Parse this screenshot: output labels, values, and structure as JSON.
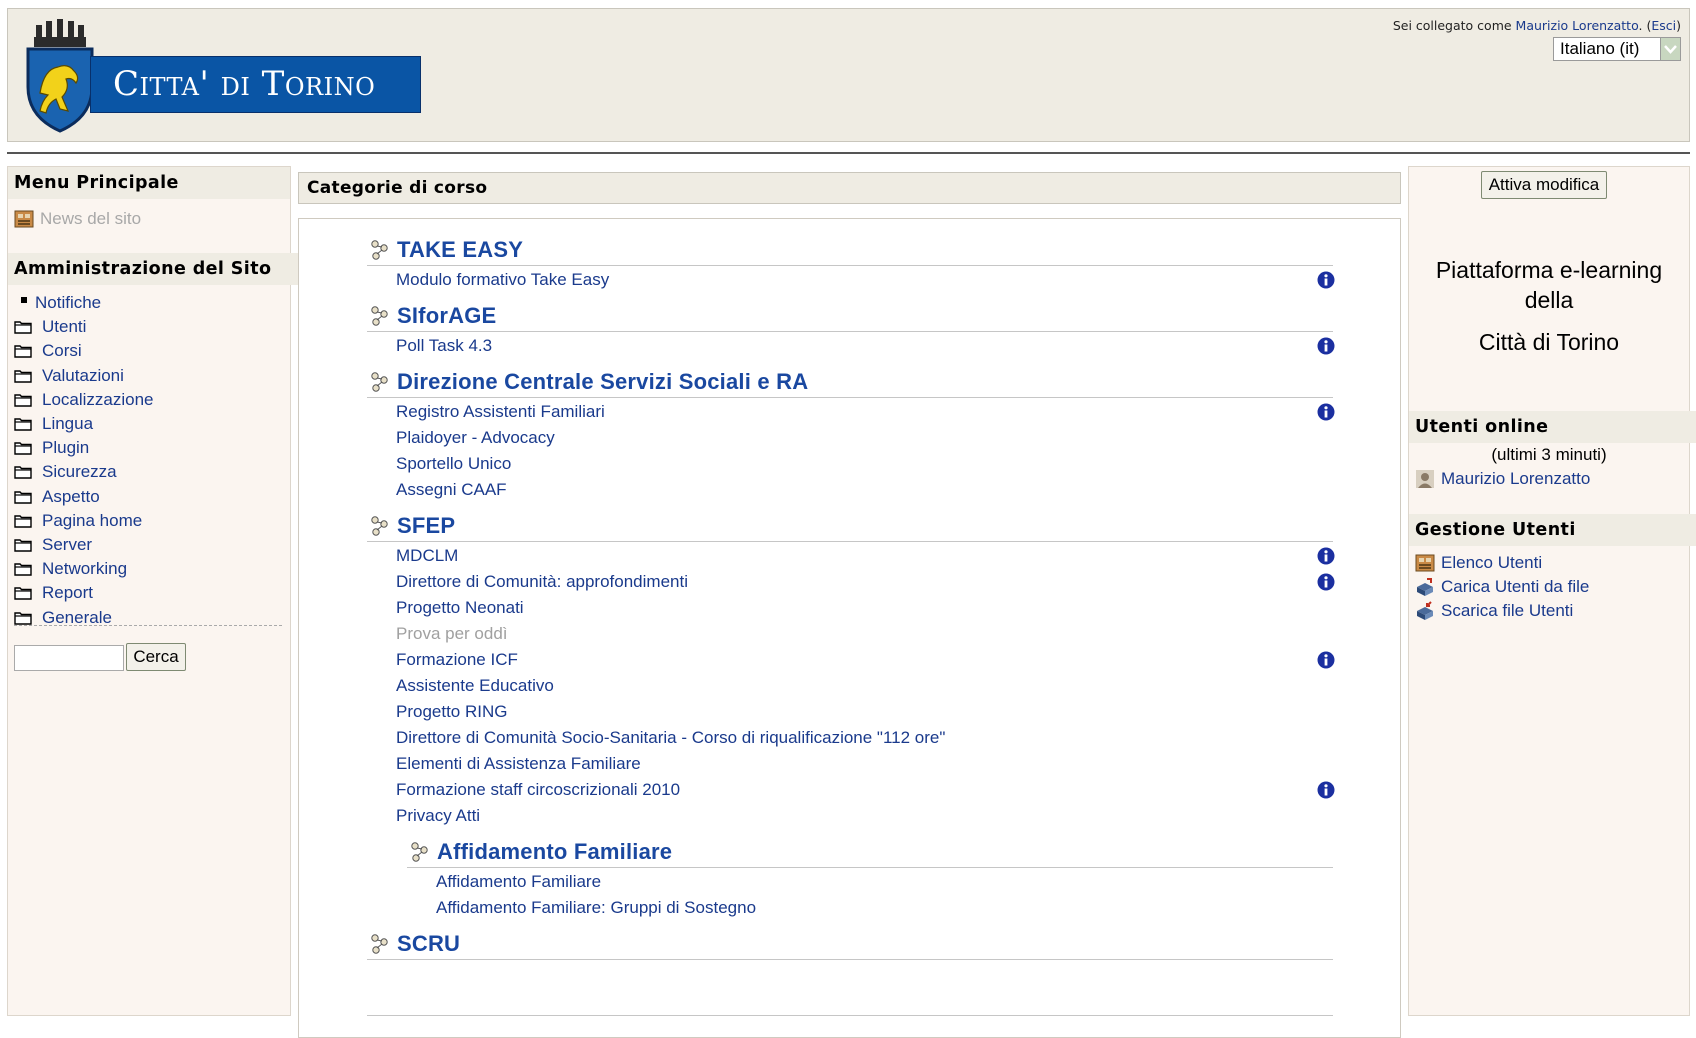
{
  "header": {
    "logo_text": "Citta' di Torino",
    "login_prefix": "Sei collegato come ",
    "user_name": "Maurizio Lorenzatto",
    "login_sep": ". (",
    "logout_label": "Esci",
    "login_suffix": ")",
    "language_selected": "Italiano (it)"
  },
  "left": {
    "menu_title": "Menu Principale",
    "news_label": "News del sito",
    "admin_title": "Amministrazione del Sito",
    "notifiche": "Notifiche",
    "admin_items": [
      "Utenti",
      "Corsi",
      "Valutazioni",
      "Localizzazione",
      "Lingua",
      "Plugin",
      "Sicurezza",
      "Aspetto",
      "Pagina home",
      "Server",
      "Networking",
      "Report",
      "Generale"
    ],
    "search_value": "",
    "search_button": "Cerca"
  },
  "main": {
    "title": "Categorie di corso",
    "categories": [
      {
        "name": "TAKE EASY",
        "courses": [
          {
            "name": "Modulo formativo Take Easy",
            "info": true
          }
        ]
      },
      {
        "name": "SIforAGE",
        "courses": [
          {
            "name": "Poll Task 4.3",
            "info": true
          }
        ]
      },
      {
        "name": "Direzione Centrale Servizi Sociali e RA",
        "courses": [
          {
            "name": "Registro Assistenti Familiari",
            "info": true
          },
          {
            "name": "Plaidoyer - Advocacy",
            "info": false
          },
          {
            "name": "Sportello Unico",
            "info": false
          },
          {
            "name": "Assegni CAAF",
            "info": false
          }
        ]
      },
      {
        "name": "SFEP",
        "courses": [
          {
            "name": "MDCLM",
            "info": true
          },
          {
            "name": "Direttore di Comunità: approfondimenti",
            "info": true
          },
          {
            "name": "Progetto Neonati",
            "info": false
          },
          {
            "name": "Prova per oddì",
            "info": false,
            "dimmed": true
          },
          {
            "name": "Formazione ICF",
            "info": true
          },
          {
            "name": "Assistente Educativo",
            "info": false
          },
          {
            "name": "Progetto RING",
            "info": false
          },
          {
            "name": "Direttore di Comunità Socio-Sanitaria - Corso di riqualificazione \"112 ore\"",
            "info": false
          },
          {
            "name": "Elementi di Assistenza Familiare",
            "info": false
          },
          {
            "name": "Formazione staff circoscrizionali 2010",
            "info": true
          },
          {
            "name": "Privacy Atti",
            "info": false
          }
        ]
      },
      {
        "name": "Affidamento Familiare",
        "sub": true,
        "courses": [
          {
            "name": "Affidamento Familiare",
            "info": false
          },
          {
            "name": "Affidamento Familiare: Gruppi di Sostegno",
            "info": false
          }
        ]
      },
      {
        "name": "SCRU",
        "courses": []
      }
    ]
  },
  "right": {
    "edit_button": "Attiva modifica",
    "platform_line1": "Piattaforma e-learning della",
    "platform_line2": "Città di Torino",
    "online_title": "Utenti online",
    "online_sub": "(ultimi 3 minuti)",
    "online_user": "Maurizio Lorenzatto",
    "gestione_title": "Gestione Utenti",
    "gestione_items": [
      "Elenco Utenti",
      "Carica Utenti da file",
      "Scarica file Utenti"
    ]
  },
  "colors": {
    "link": "#1a3a8c",
    "category": "#1a48a0",
    "block_bg": "#efece3",
    "column_bg": "#fbf5f0",
    "logo_blue": "#0a55a5"
  }
}
